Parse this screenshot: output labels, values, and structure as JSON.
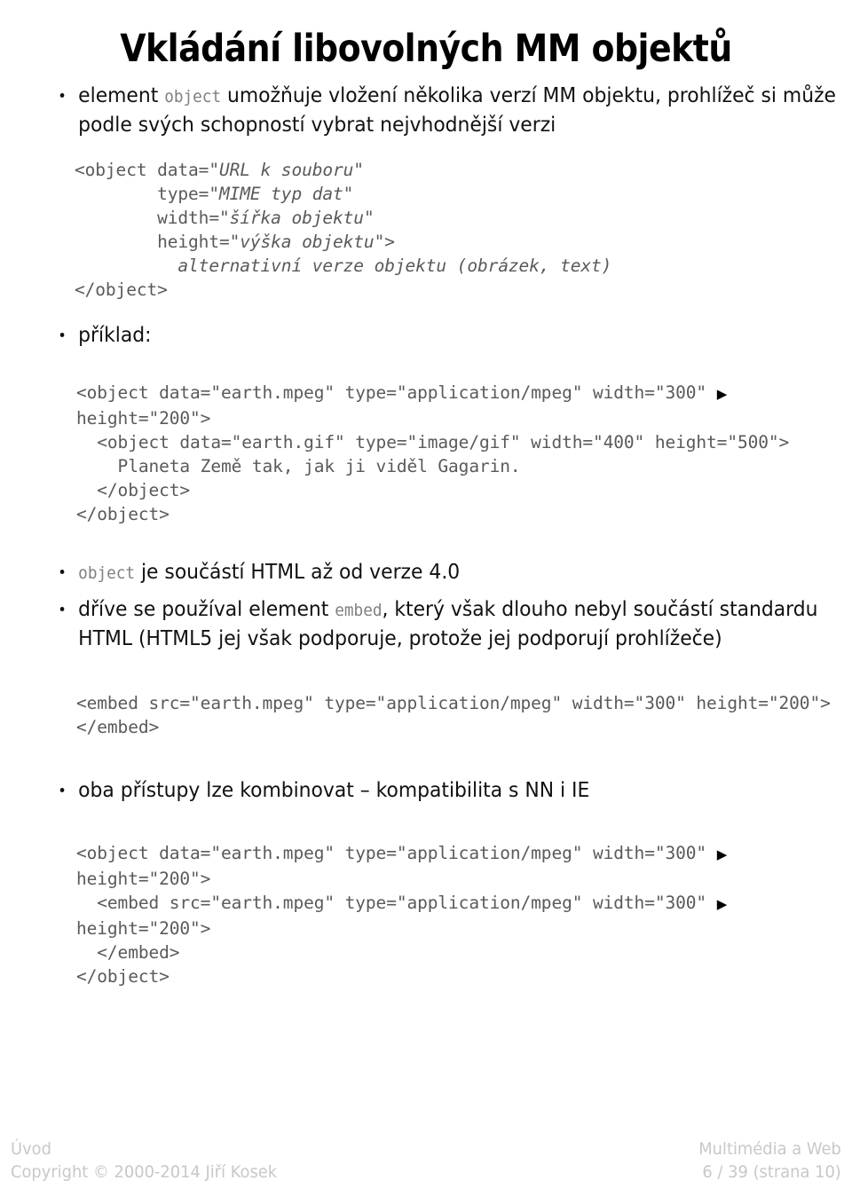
{
  "slide": {
    "title": "Vkládání libovolných MM objektů"
  },
  "bullets": {
    "b1_pre": "element ",
    "b1_code": "object",
    "b1_post": " umožňuje vložení několika verzí MM objektu, prohlížeč si může podle svých schopností vybrat nejvhodnější verzi",
    "b2": "příklad:",
    "b3_code": "object",
    "b3_post": " je součástí HTML až od verze 4.0",
    "b4_pre": "dříve se používal element ",
    "b4_code": "embed",
    "b4_post": ", který však dlouho nebyl součástí standardu HTML (HTML5 jej však podporuje, protože jej podporují prohlížeče)",
    "b5": "oba přístupy lze kombinovat – kompatibilita s NN i IE"
  },
  "code_syntax": {
    "l1_a": "<object data=\"",
    "l1_i": "URL k souboru",
    "l1_b": "\"",
    "l2_a": "        type=\"",
    "l2_i": "MIME typ dat",
    "l2_b": "\"",
    "l3_a": "        width=\"",
    "l3_i": "šířka objektu",
    "l3_b": "\"",
    "l4_a": "        height=\"",
    "l4_i": "výška objektu",
    "l4_b": "\">",
    "l5_a": "          ",
    "l5_i": "alternativní verze objektu (obrázek, text)",
    "l6": "</object>"
  },
  "code_example": {
    "l1": "<object data=\"earth.mpeg\" type=\"application/mpeg\" width=\"300\" ",
    "l1_wrap": "▶",
    "l2": "height=\"200\">",
    "l3": "  <object data=\"earth.gif\" type=\"image/gif\" width=\"400\" height=\"500\">",
    "l4": "    Planeta Země tak, jak ji viděl Gagarin.",
    "l5": "  </object>",
    "l6": "</object>"
  },
  "code_embed": {
    "l1": "<embed src=\"earth.mpeg\" type=\"application/mpeg\" width=\"300\" height=\"200\">",
    "l2": "</embed>"
  },
  "code_combined": {
    "l1": "<object data=\"earth.mpeg\" type=\"application/mpeg\" width=\"300\" ",
    "l1_wrap": "▶",
    "l2": "height=\"200\">",
    "l3": "  <embed src=\"earth.mpeg\" type=\"application/mpeg\" width=\"300\" ",
    "l3_wrap": "▶",
    "l4": "height=\"200\">",
    "l5": "  </embed>",
    "l6": "</object>"
  },
  "footer": {
    "left_top": "Úvod",
    "left_bottom": "Copyright © 2000-2014 Jiří Kosek",
    "right_top": "Multimédia a Web",
    "right_bottom": "6 / 39   (strana 10)"
  },
  "colors": {
    "text": "#111111",
    "code": "#5a5a5a",
    "inline_code": "#808080",
    "footer": "#c8c8c8",
    "background": "#ffffff"
  }
}
